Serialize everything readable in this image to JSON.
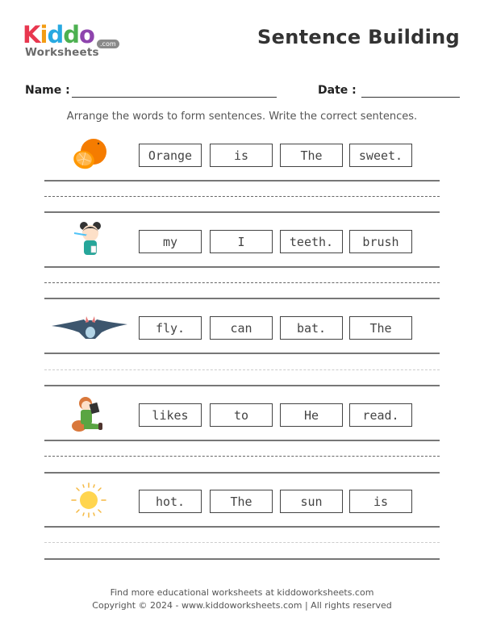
{
  "logo": {
    "letters": [
      {
        "ch": "K",
        "color": "#e8374f"
      },
      {
        "ch": "i",
        "color": "#f39c12"
      },
      {
        "ch": "d",
        "color": "#27a9e1"
      },
      {
        "ch": "d",
        "color": "#4cb050"
      },
      {
        "ch": "o",
        "color": "#8e44ad"
      }
    ],
    "subtitle": "Worksheets",
    "badge": ".com"
  },
  "header": {
    "title": "Sentence Building",
    "name_label": "Name :",
    "date_label": "Date :",
    "name_value": "",
    "date_value": ""
  },
  "instructions": "Arrange the words to form sentences. Write the correct sentences.",
  "rows": [
    {
      "picture": "orange-icon",
      "words": [
        "Orange",
        "is",
        "The",
        "sweet."
      ],
      "answer": ""
    },
    {
      "picture": "girl-brushing-teeth-icon",
      "words": [
        "my",
        "I",
        "teeth.",
        "brush"
      ],
      "answer": ""
    },
    {
      "picture": "bat-icon",
      "words": [
        "fly.",
        "can",
        "bat.",
        "The"
      ],
      "answer": ""
    },
    {
      "picture": "boy-reading-icon",
      "words": [
        "likes",
        "to",
        "He",
        "read."
      ],
      "answer": ""
    },
    {
      "picture": "sun-icon",
      "words": [
        "hot.",
        "The",
        "sun",
        "is"
      ],
      "answer": ""
    }
  ],
  "footer": {
    "line1": "Find more educational worksheets at kiddoworksheets.com",
    "line2": "Copyright © 2024 - www.kiddoworksheets.com  |  All rights reserved"
  }
}
